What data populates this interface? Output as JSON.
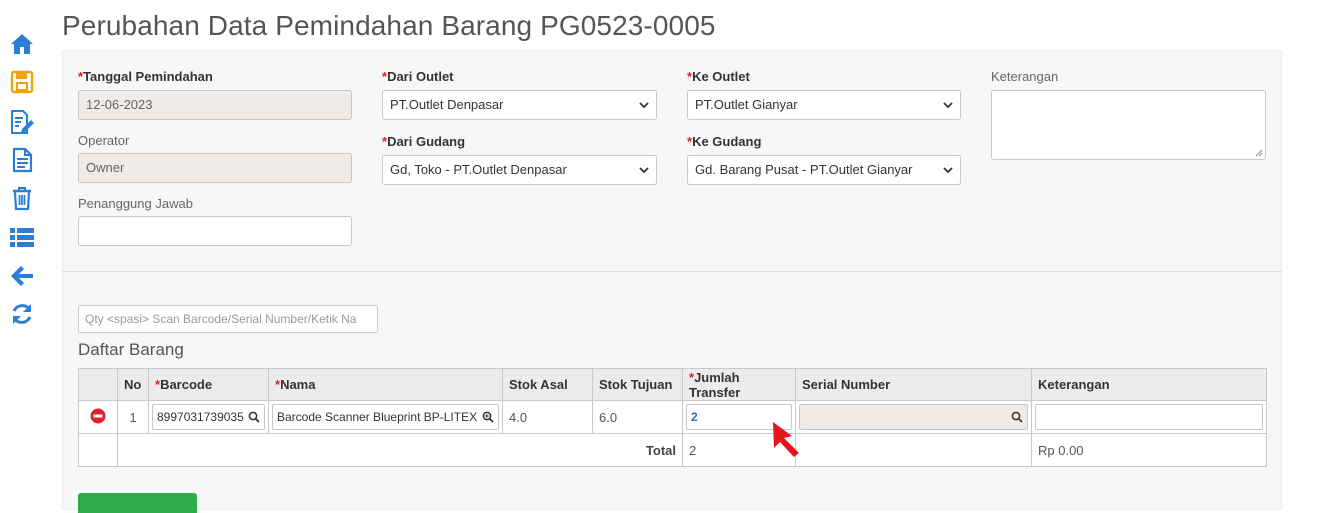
{
  "page": {
    "title": "Perubahan Data Pemindahan Barang PG0523-0005"
  },
  "sidebar": {
    "icons": [
      "home-icon",
      "save-icon",
      "edit-document-icon",
      "document-icon",
      "trash-icon",
      "list-icon",
      "back-arrow-icon",
      "refresh-icon"
    ],
    "color": "#2a7fd4",
    "save_color": "#f0a30a"
  },
  "form": {
    "tanggal": {
      "required_mark": "*",
      "label": "Tanggal Pemindahan",
      "value": "12-06-2023"
    },
    "operator": {
      "label": "Operator",
      "value": "Owner"
    },
    "penanggung": {
      "label": "Penanggung Jawab",
      "value": ""
    },
    "dari_outlet": {
      "required_mark": "*",
      "label": "Dari Outlet",
      "value": "PT.Outlet Denpasar"
    },
    "dari_gudang": {
      "required_mark": "*",
      "label": "Dari Gudang",
      "value": "Gd, Toko - PT.Outlet Denpasar"
    },
    "ke_outlet": {
      "required_mark": "*",
      "label": "Ke Outlet",
      "value": "PT.Outlet Gianyar"
    },
    "ke_gudang": {
      "required_mark": "*",
      "label": "Ke Gudang",
      "value": "Gd. Barang Pusat - PT.Outlet Gianyar"
    },
    "keterangan": {
      "label": "Keterangan",
      "value": ""
    }
  },
  "scan": {
    "placeholder": "Qty <spasi> Scan Barcode/Serial Number/Ketik Na"
  },
  "section": {
    "title": "Daftar Barang"
  },
  "table": {
    "headers": {
      "no": "No",
      "barcode": "Barcode",
      "nama": "Nama",
      "stok_asal": "Stok Asal",
      "stok_tujuan": "Stok Tujuan",
      "jumlah": "Jumlah Transfer",
      "serial": "Serial Number",
      "keterangan": "Keterangan"
    },
    "required_mark": "*",
    "rows": [
      {
        "no": "1",
        "barcode": "8997031739035",
        "nama": "Barcode Scanner Blueprint BP-LITEX",
        "stok_asal": "4.0",
        "stok_tujuan": "6.0",
        "jumlah": "2",
        "serial": "",
        "keterangan": ""
      }
    ],
    "footer": {
      "label": "Total",
      "jumlah": "2",
      "keterangan": "Rp 0.00"
    }
  },
  "colors": {
    "accent": "#2a7fd4",
    "required": "#d9232d",
    "remove": "#e0202a",
    "green_button": "#2eab4c",
    "pointer": "#e8141c"
  }
}
